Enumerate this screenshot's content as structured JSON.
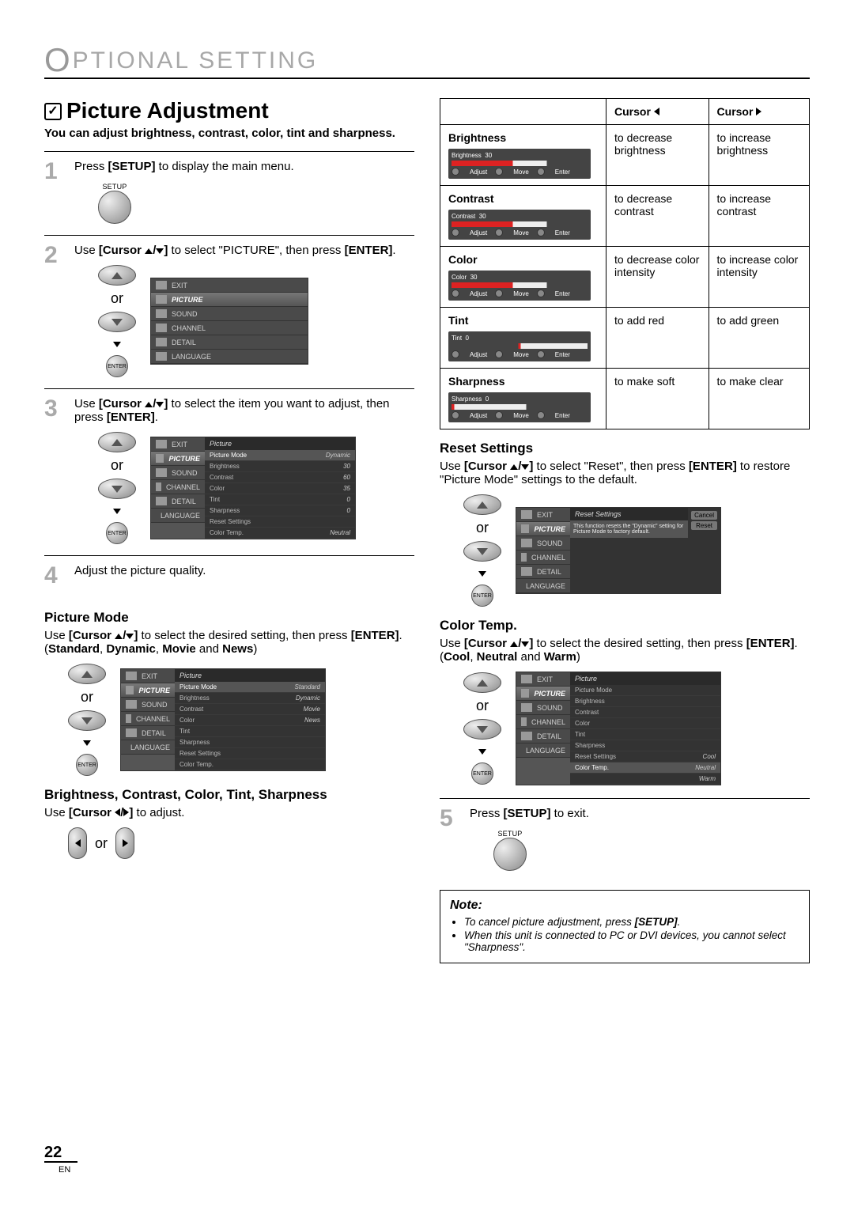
{
  "page": {
    "header_letter": "O",
    "header_rest": "PTIONAL  SETTING",
    "number": "22",
    "lang": "EN"
  },
  "title": "Picture Adjustment",
  "subtitle": "You can adjust brightness, contrast, color, tint and sharpness.",
  "steps": {
    "s1": {
      "num": "1",
      "pre": "Press ",
      "key": "[SETUP]",
      "post": " to display the main menu.",
      "button_lbl": "SETUP"
    },
    "s2": {
      "num": "2",
      "pre": "Use ",
      "key": "[Cursor ",
      "mid": "]",
      "select": " to select \"PICTURE\", then press ",
      "enter": "[ENTER]",
      "or": "or",
      "ent_lbl": "ENTER",
      "menu": [
        "EXIT",
        "PICTURE",
        "SOUND",
        "CHANNEL",
        "DETAIL",
        "LANGUAGE"
      ]
    },
    "s3": {
      "num": "3",
      "pre": "Use ",
      "key": "[Cursor ",
      "mid": "]",
      "select": " to select the item you want to adjust, then press ",
      "enter": "[ENTER]",
      "or": "or",
      "ent_lbl": "ENTER",
      "panel_head": "Picture",
      "rows": [
        {
          "l": "Picture Mode",
          "v": "Dynamic"
        },
        {
          "l": "Brightness",
          "v": "30"
        },
        {
          "l": "Contrast",
          "v": "60"
        },
        {
          "l": "Color",
          "v": "35"
        },
        {
          "l": "Tint",
          "v": "0"
        },
        {
          "l": "Sharpness",
          "v": "0"
        },
        {
          "l": "Reset Settings",
          "v": ""
        },
        {
          "l": "Color Temp.",
          "v": "Neutral"
        }
      ]
    },
    "s4": {
      "num": "4",
      "text": "Adjust the picture quality."
    },
    "s5": {
      "num": "5",
      "pre": "Press ",
      "key": "[SETUP]",
      "post": " to exit.",
      "button_lbl": "SETUP"
    }
  },
  "picture_mode": {
    "head": "Picture Mode",
    "line_a": "Use ",
    "key": "[Cursor ",
    "mid": "]",
    "line_b": " to select the desired setting, then press ",
    "enter": "[ENTER]",
    "line_c": ". (",
    "o1": "Standard",
    "c": ", ",
    "o2": "Dynamic",
    "o3": "Movie",
    "and": " and ",
    "o4": "News",
    "close": ")",
    "or": "or",
    "ent_lbl": "ENTER",
    "panel_head": "Picture",
    "rows": [
      {
        "l": "Picture Mode",
        "v": "Standard"
      },
      {
        "l": "Brightness",
        "v": "Dynamic"
      },
      {
        "l": "Contrast",
        "v": "Movie"
      },
      {
        "l": "Color",
        "v": "News"
      },
      {
        "l": "Tint",
        "v": ""
      },
      {
        "l": "Sharpness",
        "v": ""
      },
      {
        "l": "Reset Settings",
        "v": ""
      },
      {
        "l": "Color Temp.",
        "v": ""
      }
    ]
  },
  "bcts": {
    "head": "Brightness, Contrast, Color, Tint, Sharpness",
    "line_a": "Use ",
    "key": "[Cursor ",
    "mid": "]",
    "line_b": " to adjust.",
    "or": "or"
  },
  "table": {
    "cursorL": "Cursor",
    "cursorR": "Cursor",
    "brightness": {
      "name": "Brightness",
      "val": "30",
      "dec": "to decrease brightness",
      "inc": "to increase brightness"
    },
    "contrast": {
      "name": "Contrast",
      "val": "30",
      "dec": "to decrease contrast",
      "inc": "to increase contrast"
    },
    "color": {
      "name": "Color",
      "val": "30",
      "dec": "to decrease color intensity",
      "inc": "to increase color intensity"
    },
    "tint": {
      "name": "Tint",
      "val": "0",
      "dec": "to add red",
      "inc": "to add green"
    },
    "sharpness": {
      "name": "Sharpness",
      "val": "0",
      "dec": "to make soft",
      "inc": "to make clear"
    },
    "hints": {
      "adjust": "Adjust",
      "move": "Move",
      "enter": "Enter"
    }
  },
  "reset": {
    "head": "Reset Settings",
    "line_a": "Use ",
    "key": "[Cursor ",
    "mid": "]",
    "line_b": " to select \"Reset\", then press ",
    "enter": "[ENTER]",
    "line_c": " to restore \"Picture Mode\" settings to the default.",
    "or": "or",
    "ent_lbl": "ENTER",
    "panel_head": "Reset Settings",
    "dlg_text": "This function resets the \"Dynamic\" setting for Picture Mode to factory default.",
    "btn_cancel": "Cancel",
    "btn_reset": "Reset"
  },
  "colortemp": {
    "head": "Color Temp.",
    "line_a": "Use ",
    "key": "[Cursor ",
    "mid": "]",
    "line_b": " to select the desired setting, then press ",
    "enter": "[ENTER]",
    "line_c": ". (",
    "o1": "Cool",
    "c": ", ",
    "o2": "Neutral",
    "and": " and ",
    "o3": "Warm",
    "close": ")",
    "or": "or",
    "ent_lbl": "ENTER",
    "panel_head": "Picture",
    "rows": [
      {
        "l": "Picture Mode",
        "v": ""
      },
      {
        "l": "Brightness",
        "v": ""
      },
      {
        "l": "Contrast",
        "v": ""
      },
      {
        "l": "Color",
        "v": ""
      },
      {
        "l": "Tint",
        "v": ""
      },
      {
        "l": "Sharpness",
        "v": ""
      },
      {
        "l": "Reset Settings",
        "v": "Cool"
      },
      {
        "l": "Color Temp.",
        "v": "Neutral"
      },
      {
        "l": "",
        "v": "Warm"
      }
    ]
  },
  "note": {
    "head": "Note:",
    "n1a": "To cancel picture adjustment, press ",
    "n1b": "[SETUP]",
    "n1c": ".",
    "n2": "When this unit is connected to PC or DVI devices, you cannot select \"Sharpness\"."
  },
  "menu_items": [
    "EXIT",
    "PICTURE",
    "SOUND",
    "CHANNEL",
    "DETAIL",
    "LANGUAGE"
  ]
}
